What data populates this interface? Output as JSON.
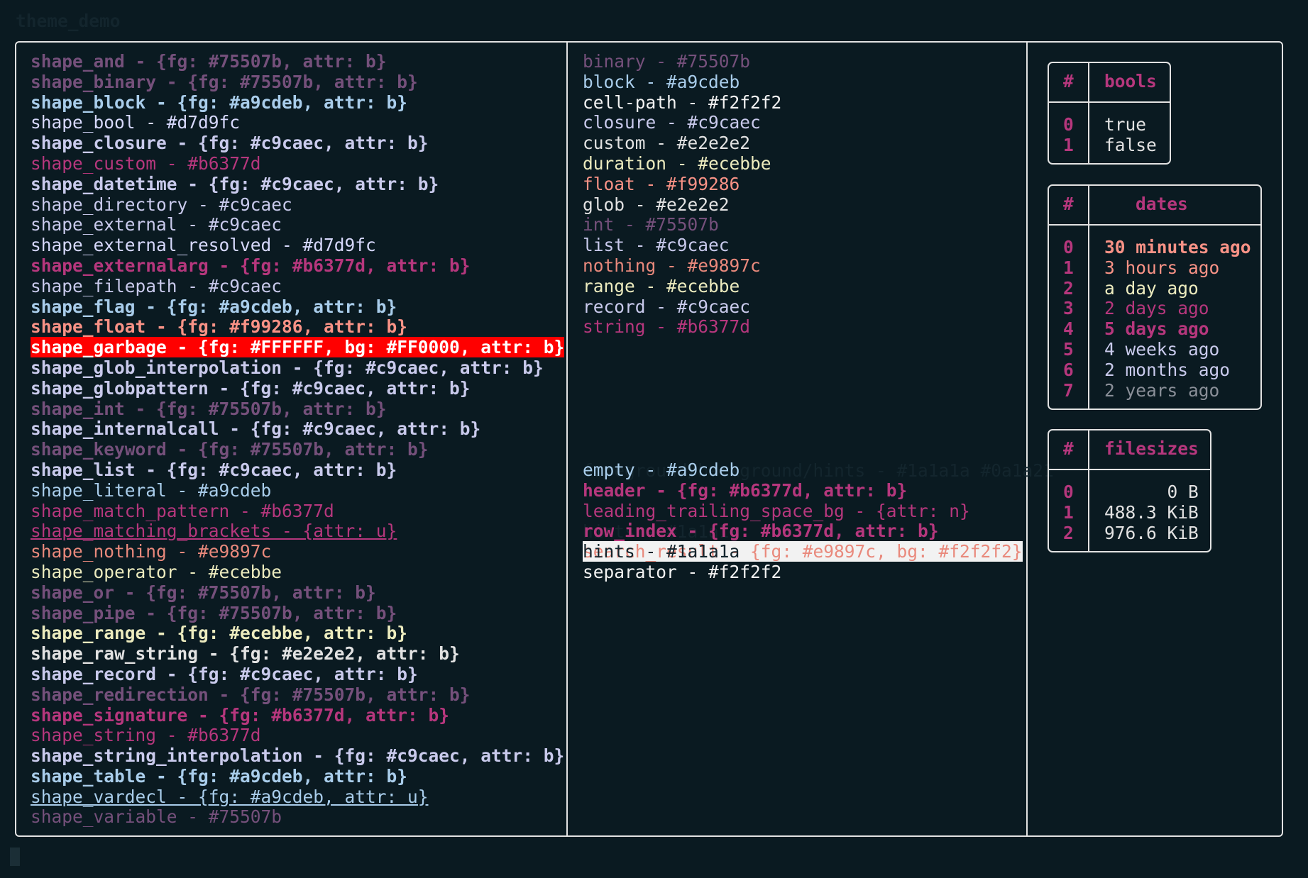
{
  "window": {
    "title": "theme_demo"
  },
  "shape_list": [
    {
      "text": "shape_and - {fg: #75507b, attr: b}",
      "fg": "#75507b",
      "bold": true
    },
    {
      "text": "shape_binary - {fg: #75507b, attr: b}",
      "fg": "#75507b",
      "bold": true
    },
    {
      "text": "shape_block - {fg: #a9cdeb, attr: b}",
      "fg": "#a9cdeb",
      "bold": true
    },
    {
      "text": "shape_bool - #d7d9fc",
      "fg": "#d7d9fc"
    },
    {
      "text": "shape_closure - {fg: #c9caec, attr: b}",
      "fg": "#c9caec",
      "bold": true
    },
    {
      "text": "shape_custom - #b6377d",
      "fg": "#b6377d"
    },
    {
      "text": "shape_datetime - {fg: #c9caec, attr: b}",
      "fg": "#c9caec",
      "bold": true
    },
    {
      "text": "shape_directory - #c9caec",
      "fg": "#c9caec"
    },
    {
      "text": "shape_external - #c9caec",
      "fg": "#c9caec"
    },
    {
      "text": "shape_external_resolved - #d7d9fc",
      "fg": "#d7d9fc"
    },
    {
      "text": "shape_externalarg - {fg: #b6377d, attr: b}",
      "fg": "#b6377d",
      "bold": true
    },
    {
      "text": "shape_filepath - #c9caec",
      "fg": "#c9caec"
    },
    {
      "text": "shape_flag - {fg: #a9cdeb, attr: b}",
      "fg": "#a9cdeb",
      "bold": true
    },
    {
      "text": "shape_float - {fg: #f99286, attr: b}",
      "fg": "#f99286",
      "bold": true
    },
    {
      "text": "shape_garbage - {fg: #FFFFFF, bg: #FF0000, attr: b}",
      "fg": "#FFFFFF",
      "bg": "#FF0000",
      "bold": true
    },
    {
      "text": "shape_glob_interpolation - {fg: #c9caec, attr: b}",
      "fg": "#c9caec",
      "bold": true
    },
    {
      "text": "shape_globpattern - {fg: #c9caec, attr: b}",
      "fg": "#c9caec",
      "bold": true
    },
    {
      "text": "shape_int - {fg: #75507b, attr: b}",
      "fg": "#75507b",
      "bold": true
    },
    {
      "text": "shape_internalcall - {fg: #c9caec, attr: b}",
      "fg": "#c9caec",
      "bold": true
    },
    {
      "text": "shape_keyword - {fg: #75507b, attr: b}",
      "fg": "#75507b",
      "bold": true
    },
    {
      "text": "shape_list - {fg: #c9caec, attr: b}",
      "fg": "#c9caec",
      "bold": true
    },
    {
      "text": "shape_literal - #a9cdeb",
      "fg": "#a9cdeb"
    },
    {
      "text": "shape_match_pattern - #b6377d",
      "fg": "#b6377d"
    },
    {
      "text": "shape_matching_brackets - {attr: u}",
      "fg": "#b6377d",
      "underline": true
    },
    {
      "text": "shape_nothing - #e9897c",
      "fg": "#e9897c"
    },
    {
      "text": "shape_operator - #ecebbe",
      "fg": "#ecebbe"
    },
    {
      "text": "shape_or - {fg: #75507b, attr: b}",
      "fg": "#75507b",
      "bold": true
    },
    {
      "text": "shape_pipe - {fg: #75507b, attr: b}",
      "fg": "#75507b",
      "bold": true
    },
    {
      "text": "shape_range - {fg: #ecebbe, attr: b}",
      "fg": "#ecebbe",
      "bold": true
    },
    {
      "text": "shape_raw_string - {fg: #e2e2e2, attr: b}",
      "fg": "#e2e2e2",
      "bold": true
    },
    {
      "text": "shape_record - {fg: #c9caec, attr: b}",
      "fg": "#c9caec",
      "bold": true
    },
    {
      "text": "shape_redirection - {fg: #75507b, attr: b}",
      "fg": "#75507b",
      "bold": true
    },
    {
      "text": "shape_signature - {fg: #b6377d, attr: b}",
      "fg": "#b6377d",
      "bold": true
    },
    {
      "text": "shape_string - #b6377d",
      "fg": "#b6377d"
    },
    {
      "text": "shape_string_interpolation - {fg: #c9caec, attr: b}",
      "fg": "#c9caec",
      "bold": true
    },
    {
      "text": "shape_table - {fg: #a9cdeb, attr: b}",
      "fg": "#a9cdeb",
      "bold": true
    },
    {
      "text": "shape_vardecl - {fg: #a9cdeb, attr: u}",
      "fg": "#a9cdeb",
      "underline": true
    },
    {
      "text": "shape_variable - #75507b",
      "fg": "#75507b"
    }
  ],
  "type_list": [
    {
      "text": "binary - #75507b",
      "fg": "#75507b"
    },
    {
      "text": "block - #a9cdeb",
      "fg": "#a9cdeb"
    },
    {
      "text": "cell-path - #f2f2f2",
      "fg": "#f2f2f2"
    },
    {
      "text": "closure - #c9caec",
      "fg": "#c9caec"
    },
    {
      "text": "custom - #e2e2e2",
      "fg": "#e2e2e2"
    },
    {
      "text": "duration - #ecebbe",
      "fg": "#ecebbe"
    },
    {
      "text": "float - #f99286",
      "fg": "#f99286"
    },
    {
      "text": "glob - #e2e2e2",
      "fg": "#e2e2e2"
    },
    {
      "text": "int - #75507b",
      "fg": "#75507b"
    },
    {
      "text": "list - #c9caec",
      "fg": "#c9caec"
    },
    {
      "text": "nothing - #e9897c",
      "fg": "#e9897c"
    },
    {
      "text": "range - #ecebbe",
      "fg": "#ecebbe"
    },
    {
      "text": "record - #c9caec",
      "fg": "#c9caec"
    },
    {
      "text": "string - #b6377d",
      "fg": "#b6377d"
    }
  ],
  "ui_list": [
    {
      "text": "empty - #a9cdeb",
      "fg": "#a9cdeb"
    },
    {
      "text": "header - {fg: #b6377d, attr: b}",
      "fg": "#b6377d",
      "bold": true
    },
    {
      "text": "leading_trailing_space_bg - {attr: n}",
      "fg": "#b6377d"
    },
    {
      "text": "row_index - {fg: #b6377d, attr: b}",
      "fg": "#b6377d",
      "bold": true
    },
    {
      "text": "search_result - {fg: #e9897c, bg: #f2f2f2}",
      "fg": "#e9897c",
      "bg": "#f2f2f2"
    },
    {
      "text": "separator - #f2f2f2",
      "fg": "#f2f2f2"
    }
  ],
  "bools_table": {
    "index_header": "#",
    "header": "bools",
    "rows": [
      {
        "index": "0",
        "value": "true",
        "fg": "#e2e2e2"
      },
      {
        "index": "1",
        "value": "false",
        "fg": "#e2e2e2"
      }
    ]
  },
  "dates_table": {
    "index_header": "#",
    "header": "dates",
    "rows": [
      {
        "index": "0",
        "value": "30 minutes ago",
        "fg": "#f99286",
        "bold": true
      },
      {
        "index": "1",
        "value": "3 hours ago",
        "fg": "#f99286"
      },
      {
        "index": "2",
        "value": "a day ago",
        "fg": "#ecebbe"
      },
      {
        "index": "3",
        "value": "2 days ago",
        "fg": "#b6377d"
      },
      {
        "index": "4",
        "value": "5 days ago",
        "fg": "#b6377d",
        "bold": true
      },
      {
        "index": "5",
        "value": "4 weeks ago",
        "fg": "#c9caec"
      },
      {
        "index": "6",
        "value": "2 months ago",
        "fg": "#c9caec"
      },
      {
        "index": "7",
        "value": "2 years ago",
        "fg": "#8a8f98"
      }
    ]
  },
  "filesizes_table": {
    "index_header": "#",
    "header": "filesizes",
    "rows": [
      {
        "index": "0",
        "value": "      0 B",
        "fg": "#e2e2e2"
      },
      {
        "index": "1",
        "value": "488.3 KiB",
        "fg": "#e2e2e2"
      },
      {
        "index": "2",
        "value": "976.6 KiB",
        "fg": "#e2e2e2"
      }
    ]
  }
}
